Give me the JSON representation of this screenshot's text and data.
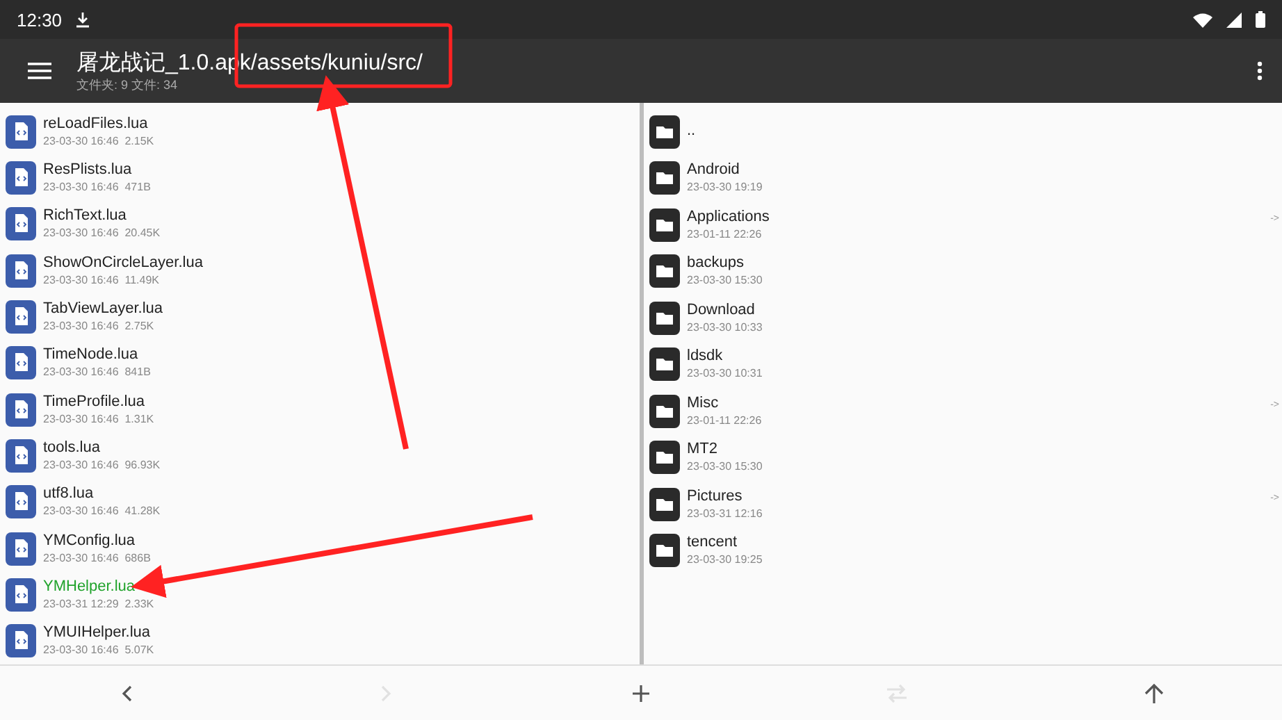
{
  "status_bar": {
    "time": "12:30"
  },
  "toolbar": {
    "title": "屠龙战记_1.0.apk/assets/kuniu/src/",
    "subtitle": "文件夹: 9  文件: 34"
  },
  "left_pane": {
    "files": [
      {
        "name": "reLoadFiles.lua",
        "date": "23-03-30 16:46",
        "size": "2.15K",
        "highlighted": false
      },
      {
        "name": "ResPlists.lua",
        "date": "23-03-30 16:46",
        "size": "471B",
        "highlighted": false
      },
      {
        "name": "RichText.lua",
        "date": "23-03-30 16:46",
        "size": "20.45K",
        "highlighted": false
      },
      {
        "name": "ShowOnCircleLayer.lua",
        "date": "23-03-30 16:46",
        "size": "11.49K",
        "highlighted": false
      },
      {
        "name": "TabViewLayer.lua",
        "date": "23-03-30 16:46",
        "size": "2.75K",
        "highlighted": false
      },
      {
        "name": "TimeNode.lua",
        "date": "23-03-30 16:46",
        "size": "841B",
        "highlighted": false
      },
      {
        "name": "TimeProfile.lua",
        "date": "23-03-30 16:46",
        "size": "1.31K",
        "highlighted": false
      },
      {
        "name": "tools.lua",
        "date": "23-03-30 16:46",
        "size": "96.93K",
        "highlighted": false
      },
      {
        "name": "utf8.lua",
        "date": "23-03-30 16:46",
        "size": "41.28K",
        "highlighted": false
      },
      {
        "name": "YMConfig.lua",
        "date": "23-03-30 16:46",
        "size": "686B",
        "highlighted": false
      },
      {
        "name": "YMHelper.lua",
        "date": "23-03-31 12:29",
        "size": "2.33K",
        "highlighted": true
      },
      {
        "name": "YMUIHelper.lua",
        "date": "23-03-30 16:46",
        "size": "5.07K",
        "highlighted": false
      }
    ]
  },
  "right_pane": {
    "folders": [
      {
        "name": ".."
      },
      {
        "name": "Android",
        "date": "23-03-30 19:19"
      },
      {
        "name": "Applications",
        "date": "23-01-11 22:26",
        "link": "->"
      },
      {
        "name": "backups",
        "date": "23-03-30 15:30"
      },
      {
        "name": "Download",
        "date": "23-03-30 10:33"
      },
      {
        "name": "ldsdk",
        "date": "23-03-30 10:31"
      },
      {
        "name": "Misc",
        "date": "23-01-11 22:26",
        "link": "->"
      },
      {
        "name": "MT2",
        "date": "23-03-30 15:30"
      },
      {
        "name": "Pictures",
        "date": "23-03-31 12:16",
        "link": "->"
      },
      {
        "name": "tencent",
        "date": "23-03-30 19:25"
      }
    ]
  },
  "bottom_bar": [
    {
      "kind": "back",
      "disabled": false
    },
    {
      "kind": "forward",
      "disabled": true
    },
    {
      "kind": "add",
      "disabled": false
    },
    {
      "kind": "swap",
      "disabled": true
    },
    {
      "kind": "up",
      "disabled": false
    }
  ]
}
